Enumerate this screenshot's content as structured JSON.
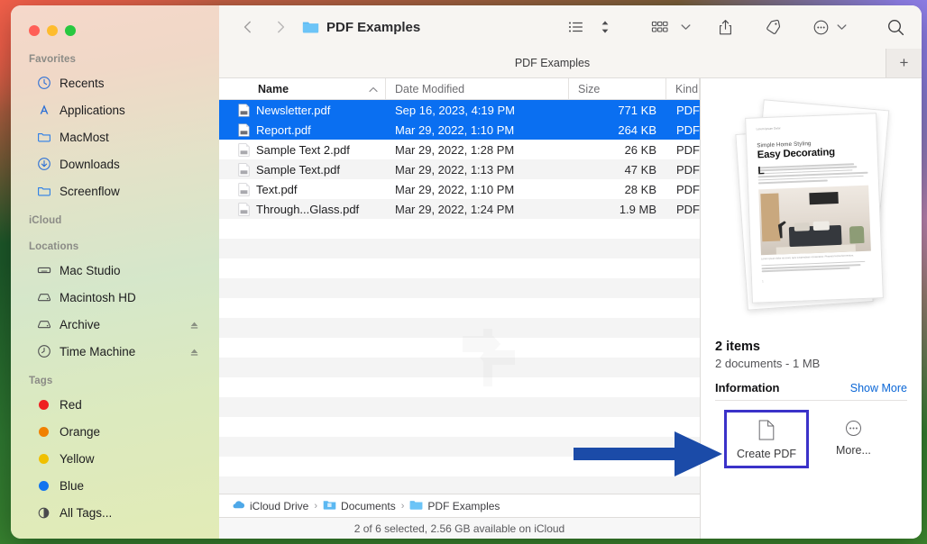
{
  "window": {
    "traffic_lights": [
      "close",
      "minimize",
      "zoom"
    ],
    "colors": {
      "selection_blue": "#0a6ff1",
      "annotation_blue": "#1b4ba8",
      "highlight_border": "#3b32c9",
      "link_blue": "#0a66d6"
    }
  },
  "sidebar": {
    "sections": [
      {
        "title": "Favorites",
        "items": [
          {
            "label": "Recents",
            "icon": "clock-icon"
          },
          {
            "label": "Applications",
            "icon": "applications-icon"
          },
          {
            "label": "MacMost",
            "icon": "folder-icon"
          },
          {
            "label": "Downloads",
            "icon": "download-icon"
          },
          {
            "label": "Screenflow",
            "icon": "folder-icon"
          }
        ]
      },
      {
        "title": "iCloud",
        "items": []
      },
      {
        "title": "Locations",
        "items": [
          {
            "label": "Mac Studio",
            "icon": "computer-icon"
          },
          {
            "label": "Macintosh HD",
            "icon": "harddisk-icon"
          },
          {
            "label": "Archive",
            "icon": "harddisk-icon",
            "eject": true
          },
          {
            "label": "Time Machine",
            "icon": "timemachine-icon",
            "eject": true
          }
        ]
      },
      {
        "title": "Tags",
        "items": [
          {
            "label": "Red",
            "icon": "tag-dot",
            "color": "#ef2020"
          },
          {
            "label": "Orange",
            "icon": "tag-dot",
            "color": "#f08000"
          },
          {
            "label": "Yellow",
            "icon": "tag-dot",
            "color": "#f0c000"
          },
          {
            "label": "Blue",
            "icon": "tag-dot",
            "color": "#1274ef"
          },
          {
            "label": "All Tags...",
            "icon": "alltags-icon"
          }
        ]
      }
    ]
  },
  "toolbar": {
    "back_label": "Back",
    "forward_label": "Forward",
    "folder_title": "PDF Examples",
    "view_as_list_label": "List View",
    "sort_label": "Sort",
    "group_label": "Group",
    "share_label": "Share",
    "tag_label": "Tags",
    "action_label": "More Actions",
    "search_label": "Search"
  },
  "tabbar": {
    "active_tab": "PDF Examples",
    "add_tab_label": "+"
  },
  "file_list": {
    "columns": [
      "Name",
      "Date Modified",
      "Size",
      "Kind"
    ],
    "sort_column": "Name",
    "sort_direction": "ascending",
    "rows": [
      {
        "name": "Newsletter.pdf",
        "date": "Sep 16, 2023, 4:19 PM",
        "size": "771 KB",
        "kind": "PDF D",
        "selected": true
      },
      {
        "name": "Report.pdf",
        "date": "Mar 29, 2022, 1:10 PM",
        "size": "264 KB",
        "kind": "PDF D",
        "selected": true
      },
      {
        "name": "Sample Text 2.pdf",
        "date": "Mar 29, 2022, 1:28 PM",
        "size": "26 KB",
        "kind": "PDF D",
        "selected": false
      },
      {
        "name": "Sample Text.pdf",
        "date": "Mar 29, 2022, 1:13 PM",
        "size": "47 KB",
        "kind": "PDF D",
        "selected": false
      },
      {
        "name": "Text.pdf",
        "date": "Mar 29, 2022, 1:10 PM",
        "size": "28 KB",
        "kind": "PDF D",
        "selected": false
      },
      {
        "name": "Through...Glass.pdf",
        "date": "Mar 29, 2022, 1:24 PM",
        "size": "1.9 MB",
        "kind": "PDF D",
        "selected": false
      }
    ]
  },
  "preview": {
    "thumbnail": {
      "kicker": "Lorem Ipsum Dolor",
      "subtitle": "Simple Home Styling",
      "title": "Easy Decorating",
      "dropcap": "L",
      "caption": "Lorem ipsum dolor sit amet, quis suspendisse consectetur. Pharetra lectus fermentum.",
      "page_number": "1"
    },
    "item_count": "2 items",
    "item_detail": "2 documents - 1 MB",
    "information_label": "Information",
    "show_more_label": "Show More",
    "actions": [
      {
        "label": "Create PDF",
        "icon": "document-icon",
        "highlighted": true
      },
      {
        "label": "More...",
        "icon": "ellipsis-circle-icon",
        "highlighted": false
      }
    ]
  },
  "pathbar": {
    "crumbs": [
      {
        "label": "iCloud Drive",
        "icon": "icloud-icon"
      },
      {
        "label": "Documents",
        "icon": "documents-folder-icon"
      },
      {
        "label": "PDF Examples",
        "icon": "folder-icon"
      }
    ],
    "separator": "›"
  },
  "statusbar": {
    "text": "2 of 6 selected, 2.56 GB available on iCloud"
  }
}
